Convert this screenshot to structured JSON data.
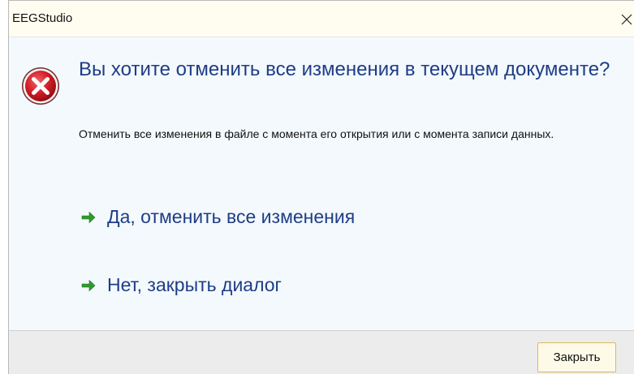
{
  "window": {
    "title": "EEGStudio"
  },
  "dialog": {
    "icon": "error-icon",
    "main_instruction": "Вы хотите отменить все изменения в текущем документе?",
    "content": "Отменить все изменения в файле с момента его открытия или с момента записи данных.",
    "commands": [
      {
        "label": "Да, отменить все изменения",
        "icon": "green-arrow-right-icon"
      },
      {
        "label": "Нет, закрыть диалог",
        "icon": "green-arrow-right-icon"
      }
    ]
  },
  "footer": {
    "close_label": "Закрыть"
  },
  "colors": {
    "instruction_text": "#1e3d87",
    "arrow_green": "#2e9a2e",
    "error_red": "#c8141b",
    "content_bg": "#f4f9fd",
    "titlebar_bg": "#fffdf0",
    "footer_bg": "#ececec",
    "button_border": "#d9b95a"
  }
}
